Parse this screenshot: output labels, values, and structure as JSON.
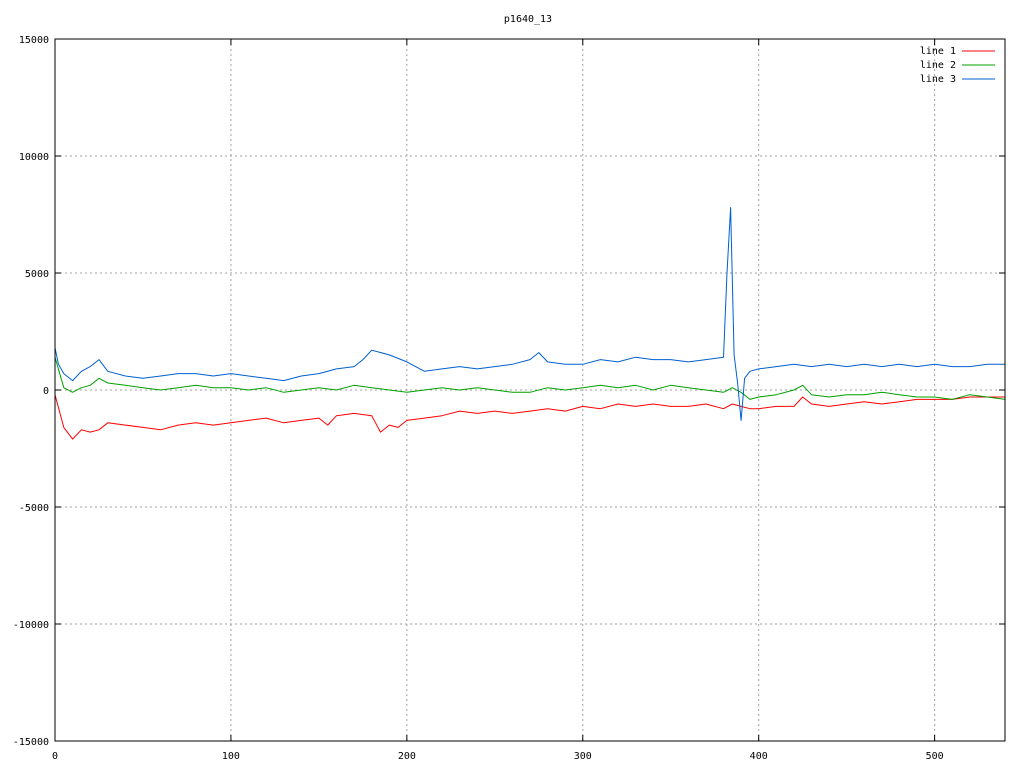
{
  "chart_data": {
    "type": "line",
    "title": "p1640_13",
    "xlabel": "",
    "ylabel": "",
    "xlim": [
      0,
      540
    ],
    "ylim": [
      -15000,
      15000
    ],
    "x_ticks": [
      0,
      100,
      200,
      300,
      400,
      500
    ],
    "y_ticks": [
      -15000,
      -10000,
      -5000,
      0,
      5000,
      10000,
      15000
    ],
    "grid": true,
    "legend_position": "top-right",
    "series": [
      {
        "name": "line 1",
        "color": "#ff0000",
        "x": [
          0,
          5,
          10,
          15,
          20,
          25,
          30,
          40,
          50,
          60,
          70,
          80,
          90,
          100,
          110,
          120,
          130,
          140,
          150,
          155,
          160,
          170,
          180,
          185,
          190,
          195,
          200,
          210,
          220,
          230,
          240,
          250,
          260,
          270,
          280,
          290,
          300,
          310,
          320,
          330,
          340,
          350,
          360,
          370,
          380,
          385,
          390,
          395,
          400,
          410,
          420,
          425,
          430,
          440,
          450,
          460,
          470,
          480,
          490,
          500,
          510,
          520,
          530,
          540
        ],
        "y": [
          -200,
          -1600,
          -2100,
          -1700,
          -1800,
          -1700,
          -1400,
          -1500,
          -1600,
          -1700,
          -1500,
          -1400,
          -1500,
          -1400,
          -1300,
          -1200,
          -1400,
          -1300,
          -1200,
          -1500,
          -1100,
          -1000,
          -1100,
          -1800,
          -1500,
          -1600,
          -1300,
          -1200,
          -1100,
          -900,
          -1000,
          -900,
          -1000,
          -900,
          -800,
          -900,
          -700,
          -800,
          -600,
          -700,
          -600,
          -700,
          -700,
          -600,
          -800,
          -600,
          -700,
          -800,
          -800,
          -700,
          -700,
          -300,
          -600,
          -700,
          -600,
          -500,
          -600,
          -500,
          -400,
          -400,
          -400,
          -300,
          -300,
          -300
        ]
      },
      {
        "name": "line 2",
        "color": "#00a000",
        "x": [
          0,
          5,
          10,
          15,
          20,
          25,
          30,
          40,
          50,
          60,
          70,
          80,
          90,
          100,
          110,
          120,
          130,
          140,
          150,
          160,
          170,
          180,
          190,
          200,
          210,
          220,
          230,
          240,
          250,
          260,
          270,
          280,
          290,
          300,
          310,
          320,
          330,
          340,
          350,
          360,
          370,
          380,
          385,
          390,
          395,
          400,
          410,
          420,
          425,
          430,
          440,
          450,
          460,
          470,
          480,
          490,
          500,
          510,
          520,
          530,
          540
        ],
        "y": [
          1400,
          100,
          -100,
          100,
          200,
          500,
          300,
          200,
          100,
          0,
          100,
          200,
          100,
          100,
          0,
          100,
          -100,
          0,
          100,
          0,
          200,
          100,
          0,
          -100,
          0,
          100,
          0,
          100,
          0,
          -100,
          -100,
          100,
          0,
          100,
          200,
          100,
          200,
          0,
          200,
          100,
          0,
          -100,
          100,
          -100,
          -400,
          -300,
          -200,
          0,
          200,
          -200,
          -300,
          -200,
          -200,
          -100,
          -200,
          -300,
          -300,
          -400,
          -200,
          -300,
          -400
        ]
      },
      {
        "name": "line 3",
        "color": "#0060d0",
        "x": [
          0,
          2,
          5,
          10,
          15,
          20,
          25,
          30,
          40,
          50,
          60,
          70,
          80,
          90,
          100,
          110,
          120,
          130,
          140,
          150,
          160,
          170,
          175,
          180,
          190,
          200,
          210,
          220,
          230,
          240,
          250,
          260,
          270,
          275,
          280,
          290,
          300,
          310,
          320,
          330,
          340,
          350,
          360,
          370,
          380,
          382,
          384,
          386,
          388,
          390,
          392,
          395,
          400,
          410,
          420,
          430,
          440,
          450,
          460,
          470,
          480,
          490,
          500,
          510,
          520,
          530,
          540
        ],
        "y": [
          1800,
          1100,
          700,
          400,
          800,
          1000,
          1300,
          800,
          600,
          500,
          600,
          700,
          700,
          600,
          700,
          600,
          500,
          400,
          600,
          700,
          900,
          1000,
          1300,
          1700,
          1500,
          1200,
          800,
          900,
          1000,
          900,
          1000,
          1100,
          1300,
          1600,
          1200,
          1100,
          1100,
          1300,
          1200,
          1400,
          1300,
          1300,
          1200,
          1300,
          1400,
          5000,
          7800,
          1500,
          300,
          -1300,
          500,
          800,
          900,
          1000,
          1100,
          1000,
          1100,
          1000,
          1100,
          1000,
          1100,
          1000,
          1100,
          1000,
          1000,
          1100,
          1100
        ]
      }
    ]
  }
}
